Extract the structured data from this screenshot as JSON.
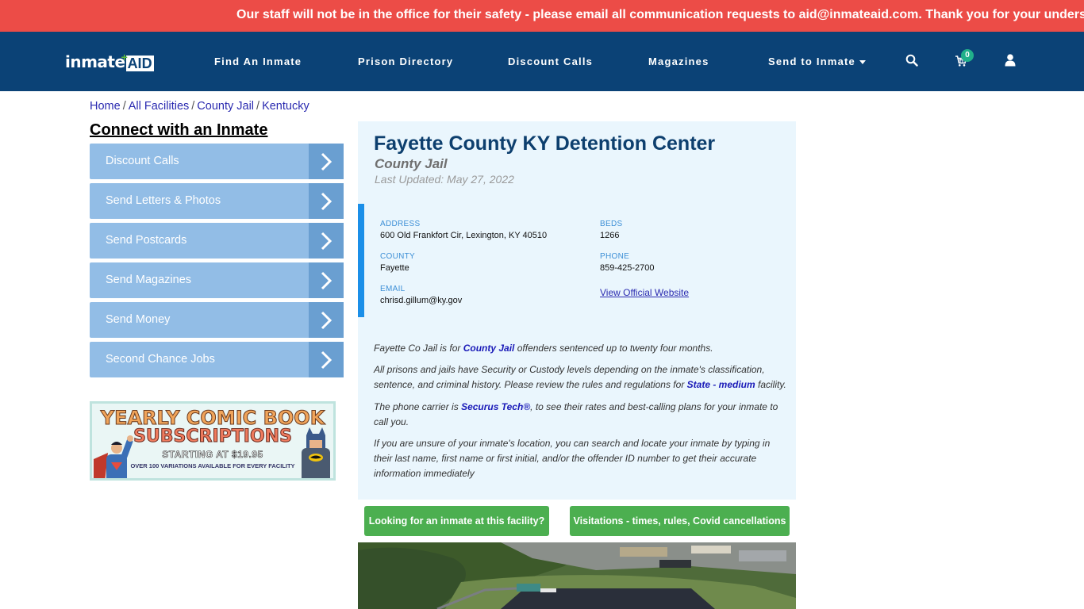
{
  "alert": {
    "text": "Our staff will not be in the office for their safety - please email all communication requests to aid@inmateaid.com. Thank you for your understanding."
  },
  "navbar": {
    "logo_part1": "inmate",
    "logo_part2": "AID",
    "items": [
      {
        "label": "Find An Inmate"
      },
      {
        "label": "Prison Directory"
      },
      {
        "label": "Discount Calls"
      },
      {
        "label": "Magazines"
      },
      {
        "label": "Send to Inmate",
        "has_dropdown": true
      }
    ],
    "icons": [
      "search-icon",
      "cart-icon",
      "user-icon"
    ],
    "cart_count": "0"
  },
  "breadcrumb": [
    {
      "label": "Home"
    },
    {
      "label": "All Facilities"
    },
    {
      "label": "County Jail"
    },
    {
      "label": "Kentucky"
    }
  ],
  "breadcrumb_separator": "/",
  "sidebar": {
    "title": "Connect with an Inmate",
    "buttons": [
      {
        "label": "Discount Calls"
      },
      {
        "label": "Send Letters & Photos"
      },
      {
        "label": "Send Postcards"
      },
      {
        "label": "Send Magazines"
      },
      {
        "label": "Send Money"
      },
      {
        "label": "Second Chance Jobs"
      }
    ],
    "ad": {
      "line1": "YEARLY COMIC BOOK",
      "line2": "SUBSCRIPTIONS",
      "line3": "STARTING AT $19.95",
      "line4": "OVER 100 VARIATIONS AVAILABLE FOR EVERY FACILITY"
    }
  },
  "facility": {
    "title": "Fayette County KY Detention Center",
    "type": "County Jail",
    "last_updated": "Last Updated: May 27, 2022",
    "info": {
      "address_label": "ADDRESS",
      "address": "600 Old Frankfort Cir, Lexington, KY 40510",
      "beds_label": "BEDS",
      "beds": "1266",
      "county_label": "COUNTY",
      "county": "Fayette",
      "phone_label": "PHONE",
      "phone": "859-425-2700",
      "email_label": "EMAIL",
      "email": "chrisd.gillum@ky.gov",
      "website_link": "View Official Website"
    },
    "description": {
      "p1_before": "Fayette Co Jail is for ",
      "p1_link": "County Jail",
      "p1_after": " offenders sentenced up to twenty four months.",
      "p2_before": "All prisons and jails have Security or Custody levels depending on the inmate's classification, sentence, and criminal history. Please review the rules and regulations for ",
      "p2_link": "State - medium",
      "p2_after": " facility.",
      "p3_before": "The phone carrier is ",
      "p3_link": "Securus Tech®",
      "p3_after": ", to see their rates and best-calling plans for your inmate to call you.",
      "p4": "If you are unsure of your inmate's location, you can search and locate your inmate by typing in their last name, first name or first initial, and/or the offender ID number to get their accurate information immediately"
    },
    "buttons": {
      "find_inmate": "Looking for an inmate at this facility?",
      "visitations": "Visitations - times, rules, Covid cancellations"
    }
  },
  "colors": {
    "alert_bg": "#ec4c47",
    "navbar_bg": "#0b4276",
    "sidebar_btn": "#92bde6",
    "sidebar_arrow": "#6a9fd1",
    "panel_bg": "#eaf6fd",
    "accent_border": "#1b8fe8",
    "green_btn": "#4caf50",
    "cart_badge": "#21b08a"
  }
}
